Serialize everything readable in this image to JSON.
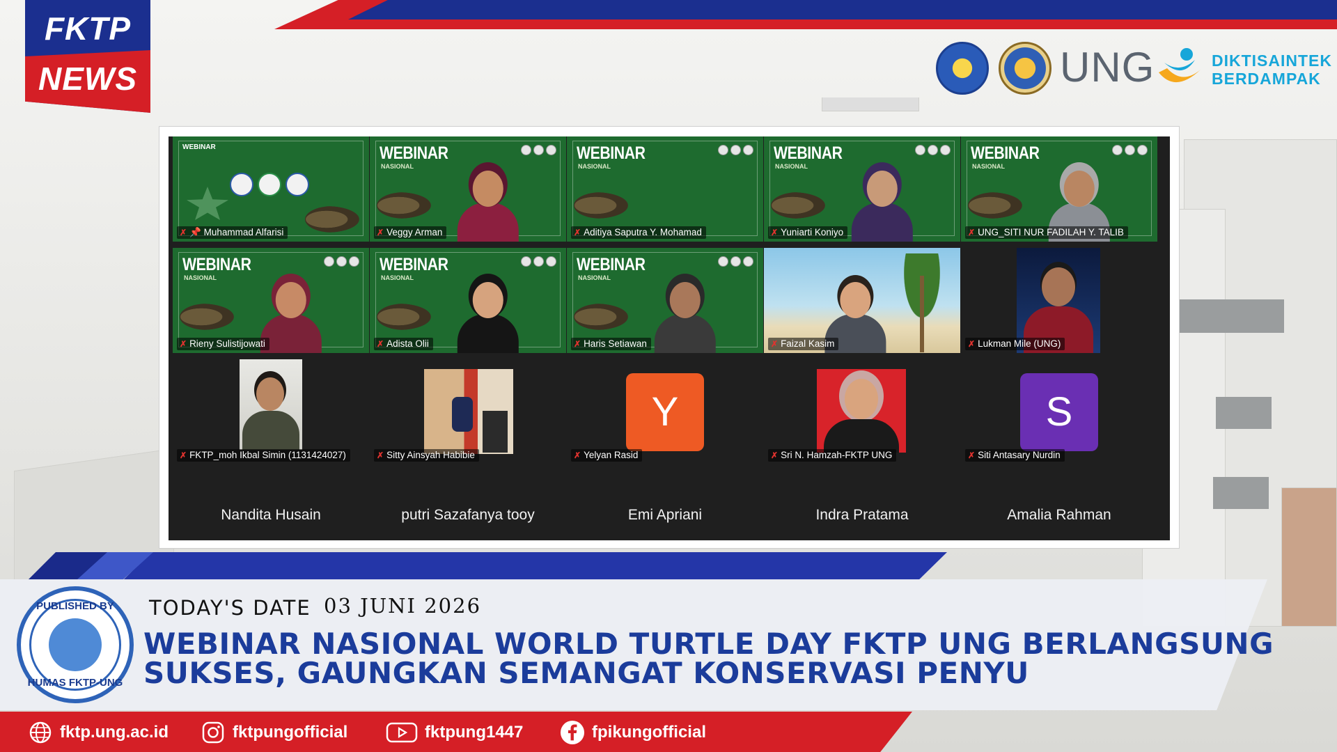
{
  "brand": {
    "news_badge_line1": "FKTP",
    "news_badge_line2": "NEWS",
    "ung_logo_text": "UNG",
    "dikti_line1": "DIKTISAINTEK",
    "dikti_line2": "BERDAMPAK"
  },
  "colors": {
    "brand_red": "#d51f26",
    "brand_blue": "#1b2f8f",
    "meeting_green": "#1e6b2f",
    "headline_blue": "#1b3c9b"
  },
  "meeting": {
    "slide_title": "WEBINAR",
    "slide_subtitle": "NASIONAL",
    "participants": [
      {
        "name": "Muhammad Alfarisi",
        "pinned": true
      },
      {
        "name": "Veggy Arman"
      },
      {
        "name": "Aditiya Saputra Y. Mohamad"
      },
      {
        "name": "Yuniarti Koniyo"
      },
      {
        "name": "UNG_SITI NUR FADILAH Y. TALIB"
      },
      {
        "name": "Rieny Sulistijowati"
      },
      {
        "name": "Adista Olii"
      },
      {
        "name": "Haris Setiawan"
      },
      {
        "name": "Faizal Kasim"
      },
      {
        "name": "Lukman Mile (UNG)"
      },
      {
        "name": "FKTP_moh Ikbal Simin (1131424027)"
      },
      {
        "name": "Sitty Ainsyah Habibie"
      },
      {
        "name": "Yelyan Rasid",
        "avatar_letter": "Y",
        "avatar_color": "#ee5a24"
      },
      {
        "name": "Sri N. Hamzah-FKTP UNG"
      },
      {
        "name": "Siti Antasary Nurdin",
        "avatar_letter": "S",
        "avatar_color": "#6a2fb3"
      }
    ],
    "name_only_row": [
      "Nandita Husain",
      "putri Sazafanya tooy",
      "Emi Apriani",
      "Indra Pratama",
      "Amalia Rahman"
    ]
  },
  "lower_third": {
    "seal_top": "PUBLISHED BY",
    "seal_bottom": "HUMAS FKTP-UNG",
    "date_label": "TODAY'S DATE",
    "date_value": "03 JUNI 2026",
    "headline_line1": "WEBINAR NASIONAL WORLD TURTLE DAY FKTP UNG BERLANGSUNG",
    "headline_line2": "SUKSES, GAUNGKAN SEMANGAT KONSERVASI PENYU"
  },
  "social": [
    {
      "icon": "globe-icon",
      "label": "fktp.ung.ac.id"
    },
    {
      "icon": "instagram-icon",
      "label": "fktpungofficial"
    },
    {
      "icon": "youtube-icon",
      "label": "fktpung1447"
    },
    {
      "icon": "facebook-icon",
      "label": "fpikungofficial"
    }
  ]
}
